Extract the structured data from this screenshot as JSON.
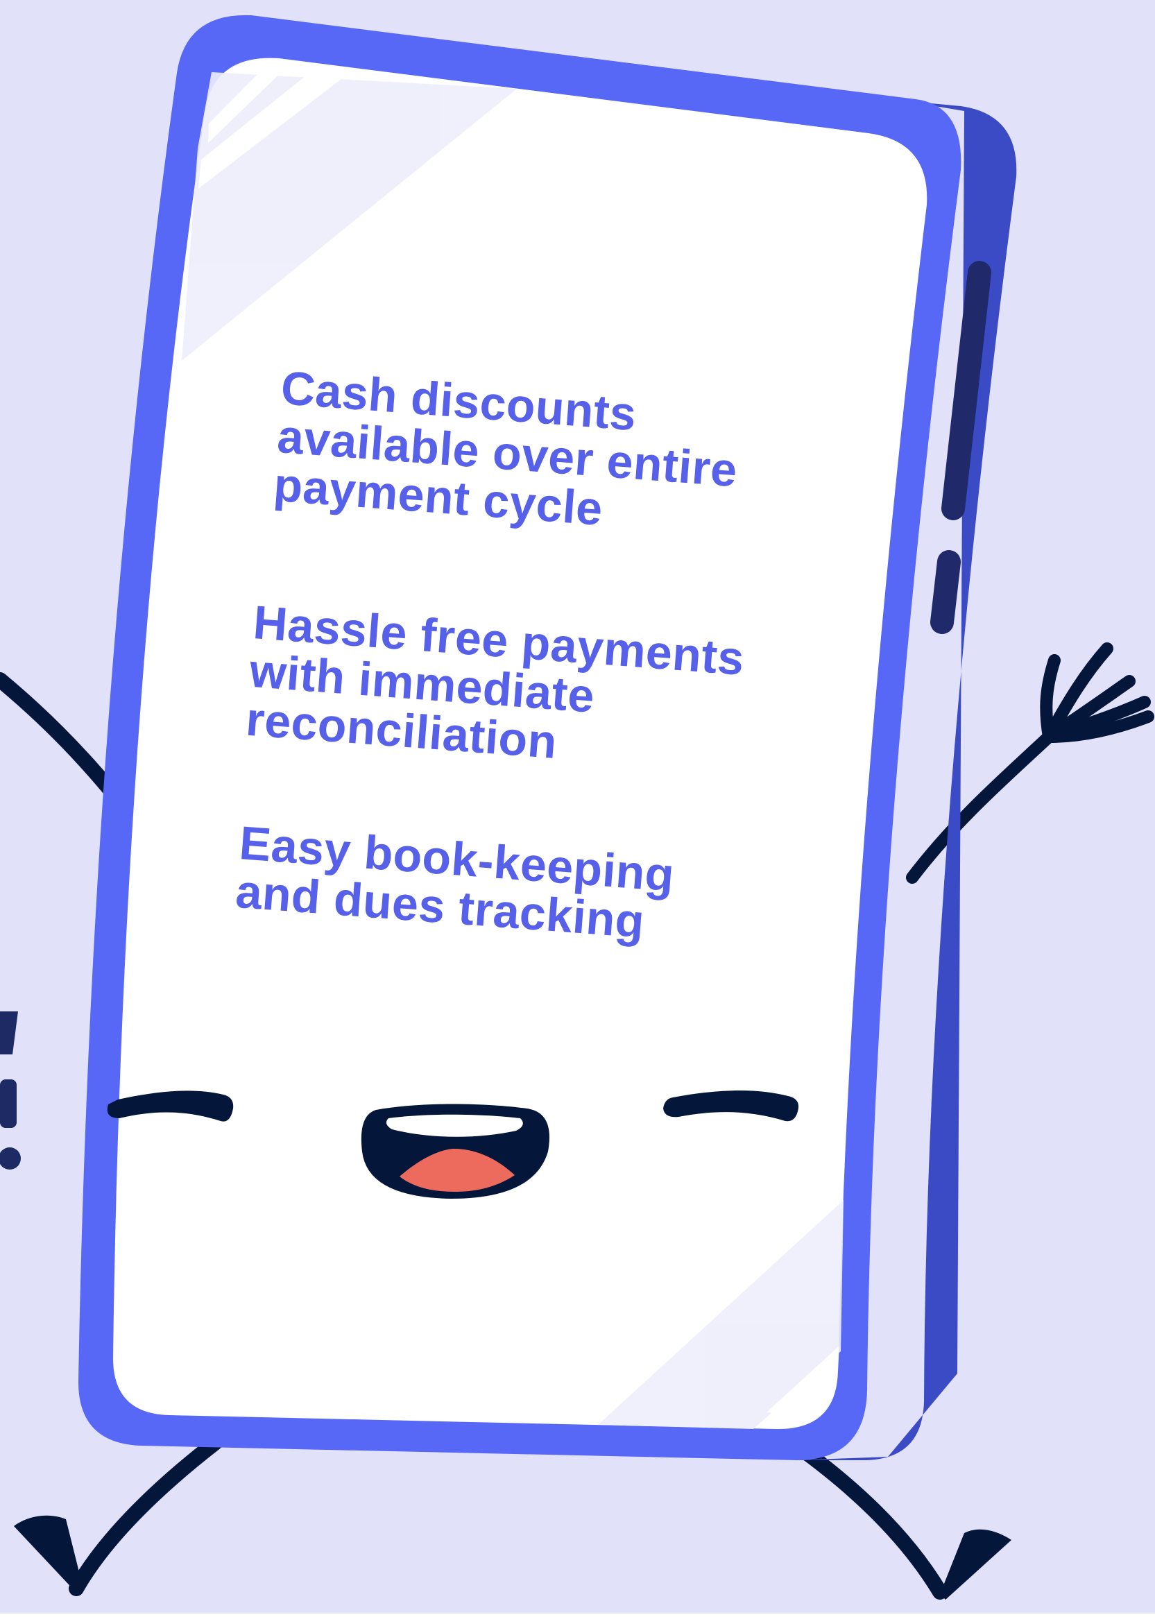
{
  "background_color": "#E1E1FA",
  "phone": {
    "body_color": "#5767F6",
    "edge_color": "#3B4BC5",
    "screen_color": "#FFFFFF",
    "button_color": "#202A6B"
  },
  "features": [
    {
      "lines": [
        "Cash discounts",
        "available over entire",
        "payment cycle"
      ]
    },
    {
      "lines": [
        "Hassle free payments",
        "with immediate",
        "reconciliation"
      ]
    },
    {
      "lines": [
        "Easy book-keeping",
        "and dues tracking"
      ]
    }
  ],
  "partial_text_left": "’!",
  "face": {
    "outline_color": "#04163A",
    "tongue_color": "#EC6B5C"
  },
  "icons": {
    "character": "phone-mascot-icon",
    "left-arm": "left-arm-icon",
    "right-arm": "right-arm-icon",
    "legs": "legs-icon"
  }
}
